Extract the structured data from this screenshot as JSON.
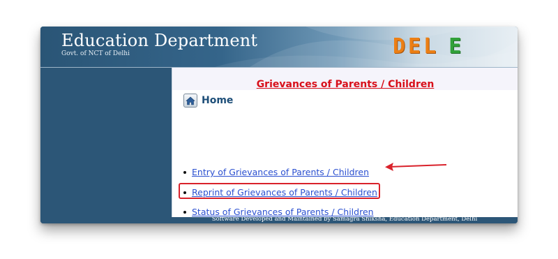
{
  "header": {
    "title": "Education Department",
    "subtitle": "Govt. of NCT of Delhi",
    "logo_part1": "DEL",
    "logo_part2": "E",
    "logo_colors": {
      "del": "#ec7f14",
      "e": "#31a13a"
    }
  },
  "main": {
    "page_title": "Grievances of Parents / Children",
    "home_label": "Home",
    "home_icon": "home-icon",
    "menu": [
      {
        "label": "Entry of Grievances of Parents / Children"
      },
      {
        "label": "Reprint of Grievances of Parents / Children",
        "highlighted": true
      },
      {
        "label": "Status of Grievances of Parents / Children"
      }
    ]
  },
  "footer": {
    "text": "Software Developed and Maintained by Samagra Shiksha, Education Department, Delhi"
  },
  "colors": {
    "sidebar": "#2c5677",
    "title_red": "#d8101a",
    "link_blue": "#2a4fd0",
    "annotation_red": "#d9222b"
  }
}
